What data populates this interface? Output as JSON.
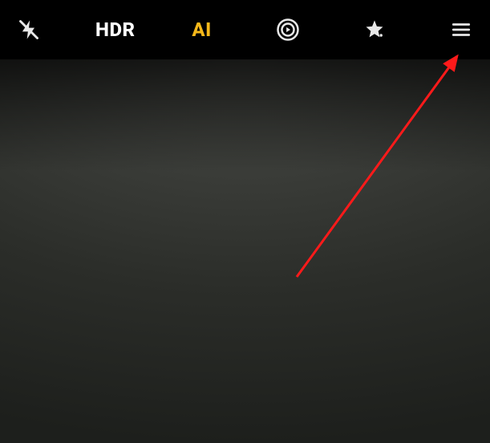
{
  "topbar": {
    "flash": "off",
    "hdr_label": "HDR",
    "ai_label": "AI",
    "ai_active": true,
    "live_photo": "on",
    "filters": "available",
    "menu": "available"
  },
  "annotation": {
    "target": "menu-button",
    "color": "#ff1a1a"
  }
}
